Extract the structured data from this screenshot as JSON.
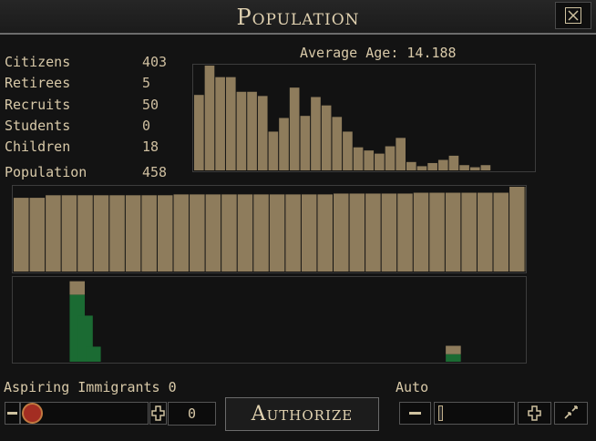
{
  "window": {
    "title": "Population"
  },
  "icons": {
    "close": "close-x-icon",
    "minus": "minus-icon",
    "plus": "plus-icon",
    "expand": "arrows-icon"
  },
  "colors": {
    "bar": "#8e7c5c",
    "recent": "#1b6b33",
    "background": "#131313",
    "text": "#d8c9a8"
  },
  "stats": [
    {
      "label": "Citizens",
      "value": "403"
    },
    {
      "label": "Retirees",
      "value": "5"
    },
    {
      "label": "Recruits",
      "value": "50"
    },
    {
      "label": "Students",
      "value": "0"
    },
    {
      "label": "Children",
      "value": "18"
    }
  ],
  "population": {
    "label": "Population",
    "value": "458"
  },
  "average_age_text": "Average Age: 14.188",
  "immigration": {
    "label": "Aspiring Immigrants 0",
    "count": "0",
    "authorize_label": "Authorize",
    "auto_label": "Auto"
  },
  "chart_data": [
    {
      "type": "bar",
      "title": "Average Age: 14.188",
      "values": [
        72,
        100,
        89,
        89,
        75,
        75,
        71,
        37,
        50,
        79,
        52,
        70,
        62,
        51,
        37,
        22,
        19,
        16,
        23,
        31,
        8,
        4,
        7,
        10,
        14,
        5,
        3,
        5
      ],
      "ylim": [
        0,
        100
      ]
    },
    {
      "type": "bar",
      "values": [
        87,
        87,
        90,
        90,
        90,
        90,
        90,
        90,
        90,
        90,
        91,
        91,
        91,
        91,
        91,
        91,
        91,
        91,
        91,
        91,
        92,
        92,
        92,
        92,
        92,
        93,
        93,
        93,
        93,
        93,
        93,
        100,
        100
      ],
      "ylim": [
        0,
        100
      ]
    },
    {
      "type": "bar",
      "stacked": true,
      "series": [
        {
          "values": [
            0,
            0,
            0,
            0,
            0,
            0,
            0,
            80,
            55,
            18,
            0,
            0,
            0,
            0,
            0,
            0,
            0,
            0,
            0,
            0,
            0,
            0,
            0,
            0,
            0,
            0,
            0,
            0,
            0,
            0,
            0,
            0,
            0,
            0,
            0,
            0,
            0,
            0,
            0,
            0,
            0,
            0,
            0,
            0,
            0,
            0,
            0,
            0,
            0,
            0,
            0,
            0,
            0,
            0,
            9,
            0,
            0,
            0,
            0,
            0,
            0,
            0,
            0,
            0
          ]
        },
        {
          "values": [
            0,
            0,
            0,
            0,
            0,
            0,
            0,
            16,
            0,
            0,
            0,
            0,
            0,
            0,
            0,
            0,
            0,
            0,
            0,
            0,
            0,
            0,
            0,
            0,
            0,
            0,
            0,
            0,
            0,
            0,
            0,
            0,
            0,
            0,
            0,
            0,
            0,
            0,
            0,
            0,
            0,
            0,
            0,
            0,
            0,
            0,
            0,
            0,
            0,
            0,
            0,
            0,
            0,
            0,
            10,
            0,
            0,
            0,
            0,
            0,
            0,
            0,
            0,
            0
          ]
        }
      ],
      "ylim": [
        0,
        100
      ]
    }
  ]
}
